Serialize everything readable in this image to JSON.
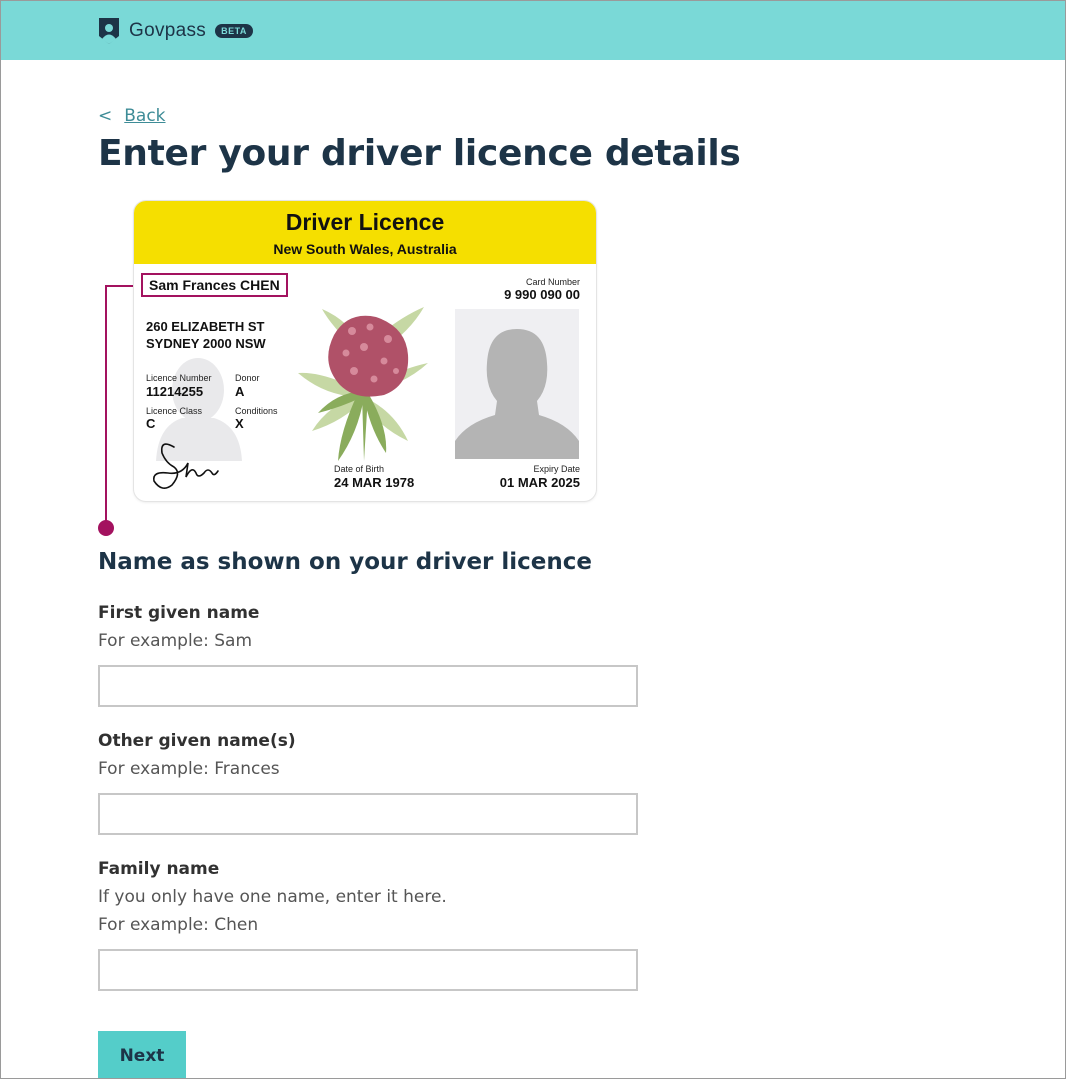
{
  "header": {
    "brand_name": "Govpass",
    "beta_badge": "BETA",
    "brand_color": "#7ad9d7"
  },
  "back": {
    "chevron": "<",
    "label": "Back"
  },
  "page_title": "Enter your driver licence details",
  "licence_card": {
    "title": "Driver Licence",
    "subtitle": "New South Wales, Australia",
    "name": "Sam Frances CHEN",
    "card_number_label": "Card Number",
    "card_number": "9 990 090 00",
    "address_line1": "260 ELIZABETH ST",
    "address_line2": "SYDNEY 2000 NSW",
    "licence_number_label": "Licence Number",
    "licence_number": "11214255",
    "donor_label": "Donor",
    "donor": "A",
    "licence_class_label": "Licence Class",
    "licence_class": "C",
    "conditions_label": "Conditions",
    "conditions": "X",
    "dob_label": "Date of Birth",
    "dob": "24 MAR 1978",
    "expiry_label": "Expiry Date",
    "expiry": "01 MAR 2025",
    "highlight_color": "#a3125f",
    "header_color": "#f5df00"
  },
  "section_title": "Name as shown on your driver licence",
  "fields": {
    "first": {
      "label": "First given name",
      "hint": "For example: Sam",
      "value": ""
    },
    "other": {
      "label": "Other given name(s)",
      "hint": "For example: Frances",
      "value": ""
    },
    "family": {
      "label": "Family name",
      "hint1": "If you only have one name, enter it here.",
      "hint2": "For example: Chen",
      "value": ""
    }
  },
  "next_button": {
    "label": "Next",
    "color": "#54cdc9"
  }
}
